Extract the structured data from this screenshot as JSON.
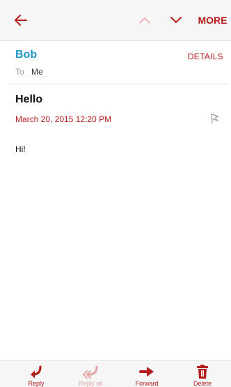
{
  "toolbar": {
    "more_label": "MORE"
  },
  "message": {
    "sender": "Bob",
    "details_label": "DETAILS",
    "to_label": "To",
    "to_value": "Me",
    "subject": "Hello",
    "date": "March 20, 2015  12:20 PM",
    "body": "Hi!"
  },
  "bottom_actions": [
    {
      "label": "Reply",
      "icon": "reply-icon",
      "enabled": true
    },
    {
      "label": "Reply all",
      "icon": "reply-all-icon",
      "enabled": false
    },
    {
      "label": "Forward",
      "icon": "forward-icon",
      "enabled": true
    },
    {
      "label": "Delete",
      "icon": "trash-icon",
      "enabled": true
    }
  ],
  "colors": {
    "accent": "#b71c1c",
    "sender": "#2196c8",
    "bar_background": "#f6f6f6"
  }
}
